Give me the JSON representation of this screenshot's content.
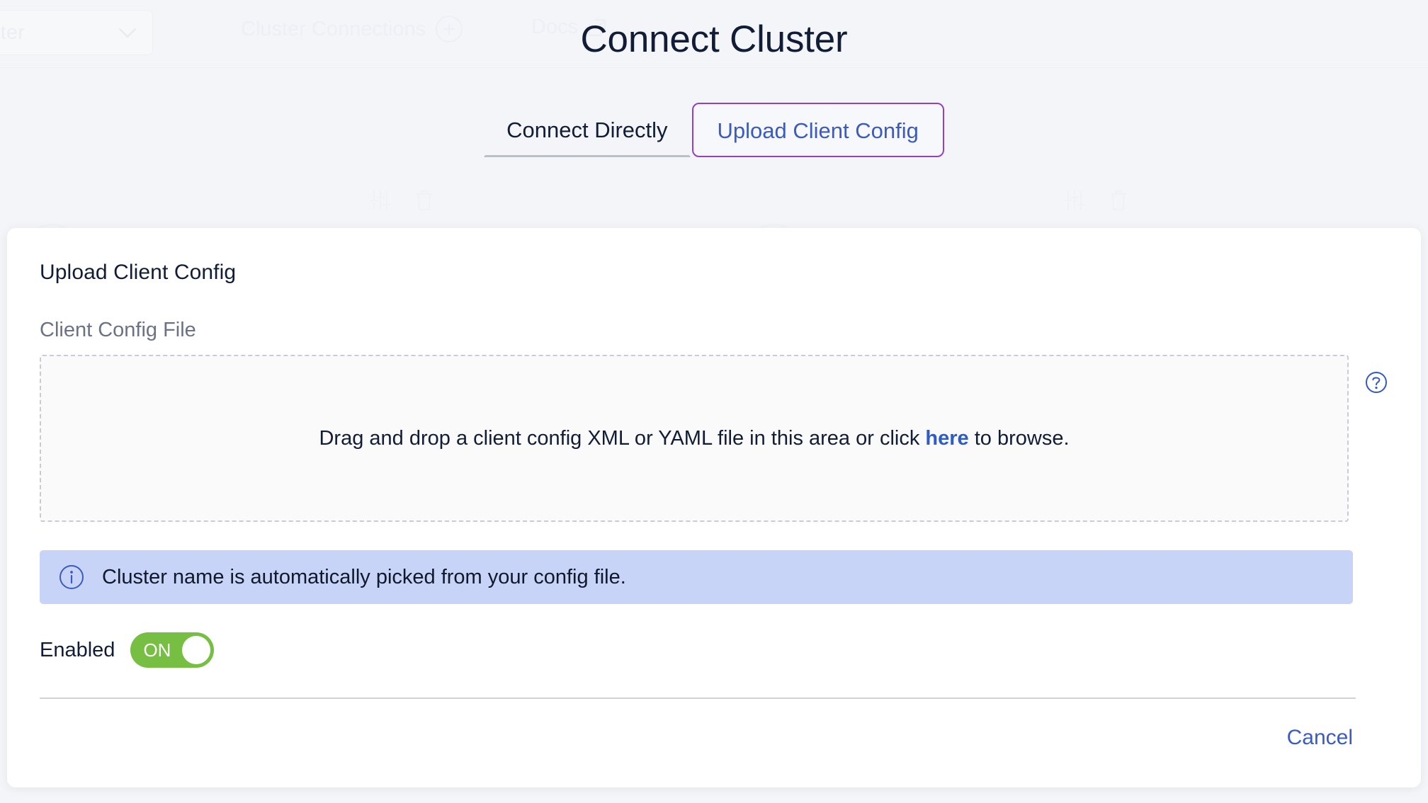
{
  "background": {
    "cluster_select_label": "luster",
    "chevron_icon": "chevron-down-icon",
    "connections_label": "Cluster Connections",
    "add_connection_icon": "circle-plus-icon",
    "docs_label": "Docs",
    "docs_external_icon": "external-link-icon",
    "card_settings_icon": "sliders-icon",
    "card_delete_icon": "trash-icon"
  },
  "modal": {
    "title": "Connect Cluster",
    "tabs": [
      {
        "label": "Connect Directly",
        "active": false
      },
      {
        "label": "Upload Client Config",
        "active": true
      }
    ],
    "panel": {
      "heading": "Upload Client Config",
      "field_label": "Client Config File",
      "dropzone": {
        "text_before": "Drag and drop a client config XML or YAML file in this area or click ",
        "link_text": "here",
        "text_after": " to browse."
      },
      "help_icon": "question-mark-circle-icon",
      "info": {
        "icon": "info-circle-icon",
        "message": "Cluster name is automatically picked from your config file."
      },
      "enabled": {
        "label": "Enabled",
        "state_text": "ON",
        "on": true
      },
      "footer": {
        "cancel_label": "Cancel"
      }
    }
  },
  "colors": {
    "page_background": "#f4f5f8",
    "panel_background": "#ffffff",
    "title_text": "#111c36",
    "active_tab_border": "#9340c4",
    "active_tab_text": "#3b5bc0",
    "link_blue": "#2d5bc8",
    "info_banner_background": "#c8d4f7",
    "toggle_on_green": "#77bf43",
    "muted_label": "#6b7285",
    "dropzone_border": "#c9ccd6"
  }
}
